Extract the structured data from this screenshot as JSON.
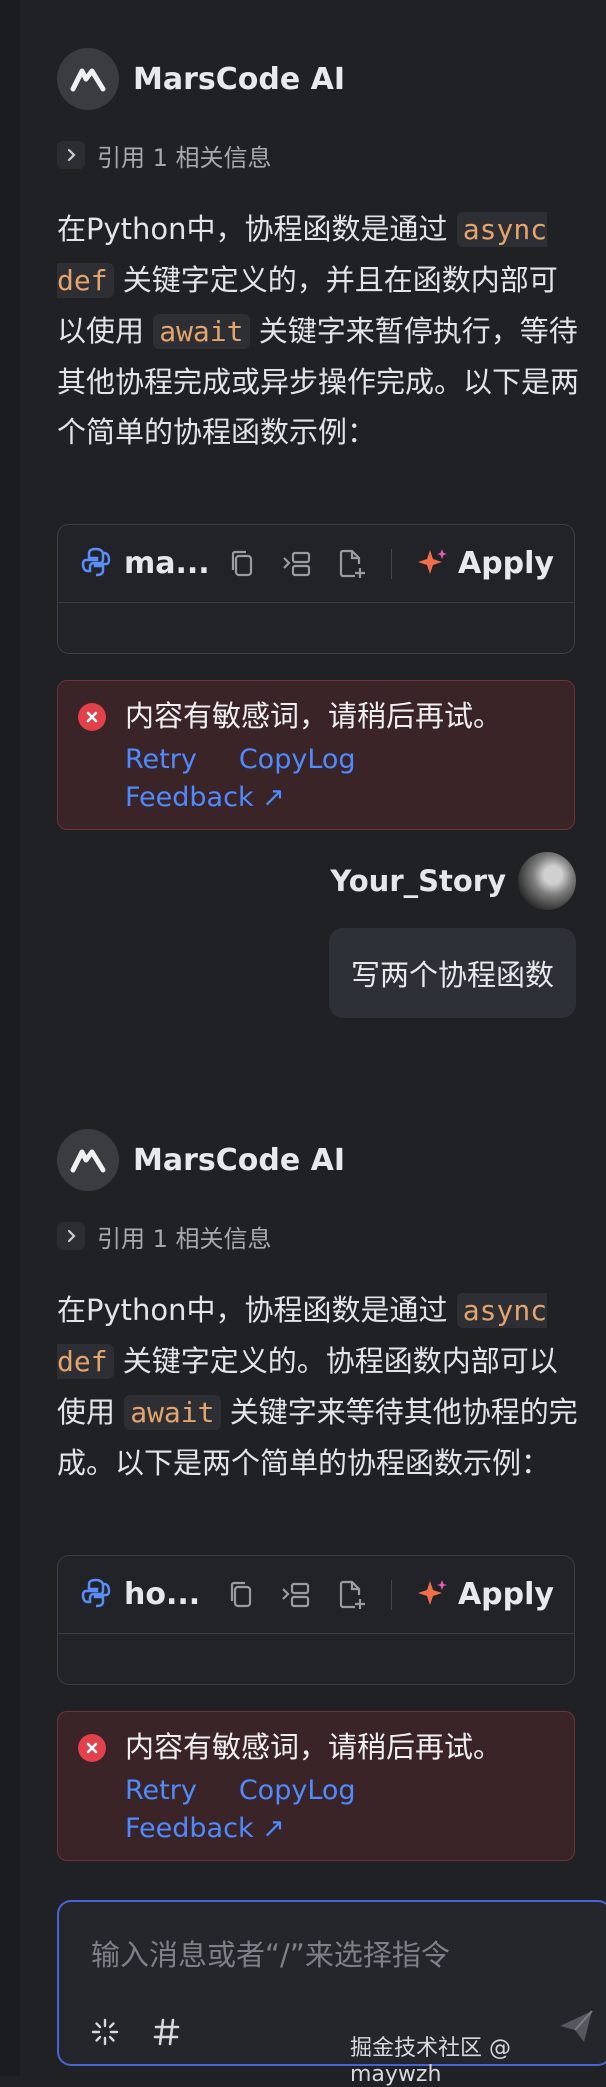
{
  "messages": [
    {
      "assistant_name": "MarsCode AI",
      "ref_label": "引用 1 相关信息",
      "text_pre": "在Python中，协程函数是通过 ",
      "code1": "async def",
      "text_mid": " 关键字定义的，并且在函数内部可以使用 ",
      "code2": "await",
      "text_post": " 关键字来暂停执行，等待其他协程完成或异步操作完成。以下是两个简单的协程函数示例：",
      "file_name": "ma...",
      "apply_label": "Apply",
      "error_title": "内容有敏感词，请稍后再试。",
      "retry": "Retry",
      "copylog": "CopyLog",
      "feedback": "Feedback ↗"
    },
    {
      "assistant_name": "MarsCode AI",
      "ref_label": "引用 1 相关信息",
      "text_pre": "在Python中，协程函数是通过 ",
      "code1": "async def",
      "text_mid": " 关键字定义的。协程函数内部可以使用 ",
      "code2": "await",
      "text_post": " 关键字来等待其他协程的完成。以下是两个简单的协程函数示例：",
      "file_name": "ho...",
      "apply_label": "Apply",
      "error_title": "内容有敏感词，请稍后再试。",
      "retry": "Retry",
      "copylog": "CopyLog",
      "feedback": "Feedback ↗"
    }
  ],
  "user": {
    "name": "Your_Story",
    "message": "写两个协程函数"
  },
  "input": {
    "placeholder": "输入消息或者“/”来选择指令"
  },
  "watermark": "掘金技术社区 @ maywzh",
  "icons": [
    "marscode-logo-icon",
    "chevron-right-icon",
    "python-icon",
    "copy-icon",
    "insert-icon",
    "new-file-icon",
    "sparkle-icon",
    "error-icon",
    "avatar",
    "magic-wand-icon",
    "hash-icon",
    "send-icon"
  ],
  "colors": {
    "background": "#202125",
    "code_inline": "#e4a46d",
    "link": "#4f8bff",
    "error_bg": "#3a2428",
    "error_icon": "#e2414b"
  }
}
